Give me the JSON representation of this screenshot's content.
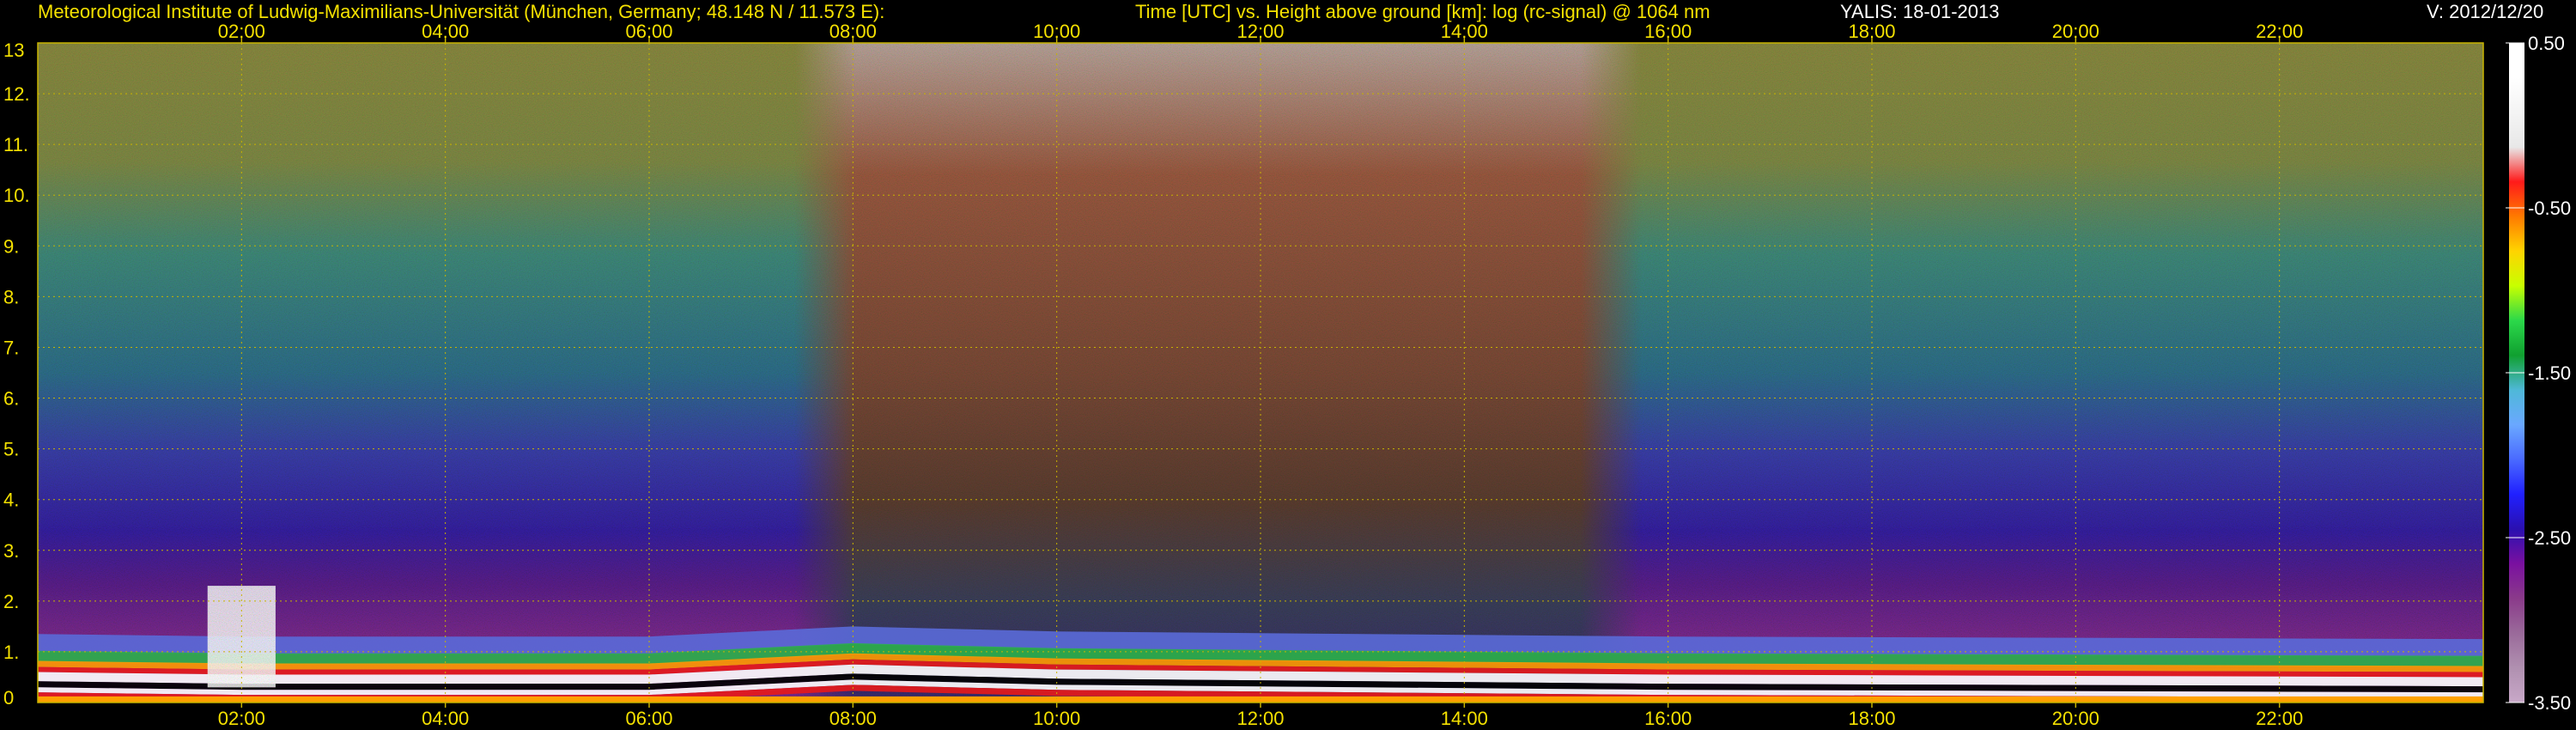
{
  "header": {
    "institute": "Meteorological Institute of Ludwig-Maximilians-Universität (München, Germany; 48.148 N / 11.573 E):",
    "description": "Time [UTC] vs. Height above ground [km]: log (rc-signal) @ 1064 nm",
    "instrument_date": "YALIS: 18-01-2013",
    "version": "V: 2012/12/20"
  },
  "colors": {
    "label_yellow": "#f5e100",
    "grid_yellow": "#c8b400",
    "background": "#000000",
    "label_white": "#ffffff"
  },
  "chart_data": {
    "type": "heatmap",
    "title": "Time [UTC] vs. Height above ground [km]: log (rc-signal) @ 1064 nm",
    "xlabel": "Time [UTC]",
    "ylabel": "Height above ground [km]",
    "xlim": [
      "00:00",
      "24:00"
    ],
    "ylim": [
      0,
      13
    ],
    "x_ticks": [
      "02:00",
      "04:00",
      "06:00",
      "08:00",
      "10:00",
      "12:00",
      "14:00",
      "16:00",
      "18:00",
      "20:00",
      "22:00"
    ],
    "y_ticks": [
      "0",
      "1.",
      "2.",
      "3.",
      "4.",
      "5.",
      "6.",
      "7.",
      "8.",
      "9.",
      "10.",
      "11.",
      "12.",
      "13"
    ],
    "grid": true,
    "colorbar": {
      "range": [
        -3.5,
        0.5
      ],
      "tick_labels": [
        "0.50",
        "-0.50",
        "-1.50",
        "-2.50",
        "-3.50"
      ],
      "position": "right"
    },
    "features": {
      "boundary_layer_top_km": [
        {
          "time": "00:00",
          "height": 0.6
        },
        {
          "time": "02:00",
          "height": 0.55
        },
        {
          "time": "06:00",
          "height": 0.55
        },
        {
          "time": "08:00",
          "height": 0.75
        },
        {
          "time": "10:00",
          "height": 0.65
        },
        {
          "time": "16:00",
          "height": 0.55
        },
        {
          "time": "24:00",
          "height": 0.5
        }
      ],
      "low_cloud_spike": {
        "time_start": "01:40",
        "time_end": "02:20",
        "top_height_km": 2.3
      },
      "daytime_noise_window": {
        "time_start": "07:40",
        "time_end": "15:30"
      }
    }
  }
}
